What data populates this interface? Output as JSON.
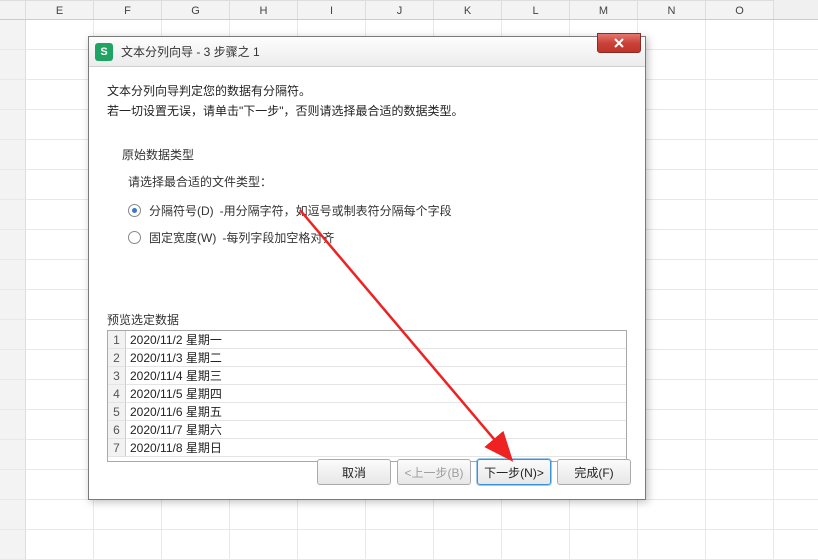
{
  "columns": [
    "E",
    "F",
    "G",
    "H",
    "I",
    "J",
    "K",
    "L",
    "M",
    "N",
    "O"
  ],
  "dialog": {
    "title": "文本分列向导 - 3 步骤之 1",
    "intro1": "文本分列向导判定您的数据有分隔符。",
    "intro2": "若一切设置无误，请单击\"下一步\"，否则请选择最合适的数据类型。",
    "section_title": "原始数据类型",
    "section_sub": "请选择最合适的文件类型：",
    "radio1_label": "分隔符号(D)",
    "radio1_desc": "-用分隔字符，如逗号或制表符分隔每个字段",
    "radio2_label": "固定宽度(W)",
    "radio2_desc": "-每列字段加空格对齐",
    "preview_label": "预览选定数据",
    "preview_data": [
      {
        "n": "1",
        "v": "2020/11/2 星期一"
      },
      {
        "n": "2",
        "v": "2020/11/3 星期二"
      },
      {
        "n": "3",
        "v": "2020/11/4 星期三"
      },
      {
        "n": "4",
        "v": "2020/11/5 星期四"
      },
      {
        "n": "5",
        "v": "2020/11/6 星期五"
      },
      {
        "n": "6",
        "v": "2020/11/7 星期六"
      },
      {
        "n": "7",
        "v": "2020/11/8 星期日"
      }
    ],
    "btn_cancel": "取消",
    "btn_prev": "<上一步(B)",
    "btn_next": "下一步(N)>",
    "btn_finish": "完成(F)"
  },
  "app_icon_letter": "S"
}
